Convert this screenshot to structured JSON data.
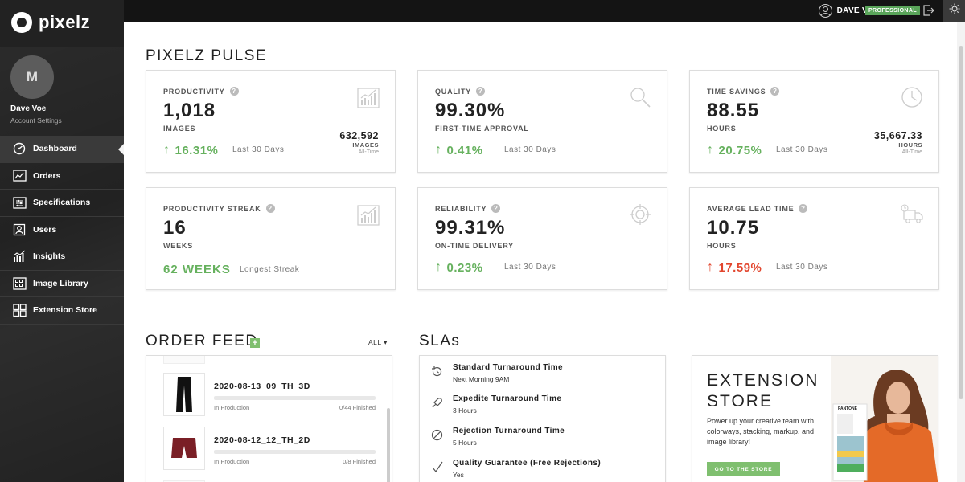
{
  "app": {
    "logo_text": "pixelz"
  },
  "sidebar": {
    "avatar_initial": "M",
    "user_name": "Dave Voe",
    "account_settings": "Account Settings",
    "items": [
      {
        "label": "Dashboard",
        "icon": "dashboard-icon",
        "active": true
      },
      {
        "label": "Orders",
        "icon": "orders-icon"
      },
      {
        "label": "Specifications",
        "icon": "specifications-icon"
      },
      {
        "label": "Users",
        "icon": "users-icon"
      },
      {
        "label": "Insights",
        "icon": "insights-icon"
      },
      {
        "label": "Image Library",
        "icon": "image-library-icon"
      },
      {
        "label": "Extension Store",
        "icon": "extension-store-icon"
      }
    ]
  },
  "topbar": {
    "username": "DAVE VOE",
    "plan": "PROFESSIONAL"
  },
  "pulse": {
    "title": "PIXELZ PULSE",
    "cards": [
      {
        "label": "PRODUCTIVITY",
        "value": "1,018",
        "unit": "IMAGES",
        "change": "16.31%",
        "period": "Last 30 Days",
        "alltime_value": "632,592",
        "alltime_unit": "IMAGES",
        "alltime_caption": "All-Time"
      },
      {
        "label": "QUALITY",
        "value": "99.30%",
        "unit": "FIRST-TIME APPROVAL",
        "change": "0.41%",
        "period": "Last 30 Days"
      },
      {
        "label": "TIME SAVINGS",
        "value": "88.55",
        "unit": "HOURS",
        "change": "20.75%",
        "period": "Last 30 Days",
        "alltime_value": "35,667.33",
        "alltime_unit": "HOURS",
        "alltime_caption": "All-Time"
      },
      {
        "label": "PRODUCTIVITY STREAK",
        "value": "16",
        "unit": "WEEKS",
        "streak": "62 WEEKS",
        "streak_caption": "Longest Streak"
      },
      {
        "label": "RELIABILITY",
        "value": "99.31%",
        "unit": "ON-TIME DELIVERY",
        "change": "0.23%",
        "period": "Last 30 Days"
      },
      {
        "label": "AVERAGE LEAD TIME",
        "value": "10.75",
        "unit": "HOURS",
        "change": "17.59%",
        "period": "Last 30 Days"
      }
    ],
    "help_glyph": "?",
    "up_arrow": "↑"
  },
  "feed": {
    "title": "ORDER FEED",
    "add_glyph": "+",
    "filter": "ALL",
    "items": [
      {
        "name": "2020-08-13_09_TH_3D",
        "status": "In Production",
        "progress": "0/44 Finished",
        "done_fraction": 0
      },
      {
        "name": "2020-08-12_12_TH_2D",
        "status": "In Production",
        "progress": "0/8 Finished",
        "done_fraction": 0
      }
    ]
  },
  "slas": {
    "title": "SLAs",
    "items": [
      {
        "title": "Standard Turnaround Time",
        "sub": "Next Morning 9AM",
        "icon": "clock-rotate-icon"
      },
      {
        "title": "Expedite Turnaround Time",
        "sub": "3 Hours",
        "icon": "rocket-icon"
      },
      {
        "title": "Rejection Turnaround Time",
        "sub": "5 Hours",
        "icon": "prohibited-icon"
      },
      {
        "title": "Quality Guarantee (Free Rejections)",
        "sub": "Yes",
        "icon": "checkmark-icon"
      }
    ]
  },
  "promo": {
    "title_line1": "EXTENSION",
    "title_line2": "STORE",
    "text": "Power up your creative team with colorways, stacking, markup, and image library!",
    "button": "GO TO THE STORE",
    "art_label": "PANTONE"
  },
  "colors": {
    "accent_green": "#66b15e",
    "bad_red": "#e2462e",
    "sidebar_bg": "#222222",
    "topbar_bg": "#141414"
  }
}
